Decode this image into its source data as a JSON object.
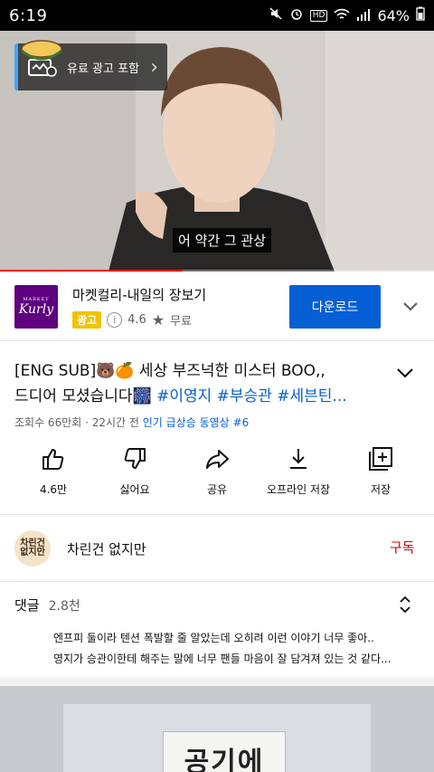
{
  "status": {
    "time": "6:19",
    "battery": "64%",
    "hd": "HD"
  },
  "video": {
    "paid_badge": "유료 광고 포함",
    "subtitle": "어 약간 그 관상",
    "progress": 0.42
  },
  "ad": {
    "logo_text": "Kurly",
    "logo_small": "MARKET",
    "title": "마켓컬리-내일의 장보기",
    "tag": "광고",
    "rating": "4.6",
    "price": "무료",
    "cta": "다운로드"
  },
  "title": {
    "line1": "[ENG SUB]🐻🍊 세상 부즈넉한 미스터 BOO,,",
    "line2_text": "드디어 모셨습니다🎆 ",
    "line2_tags": "#이영지 #부승관 #세븐틴..."
  },
  "meta": {
    "views_time": "조회수 66만회 · 22시간 전 ",
    "trending": "인기 급상승 동영상 #6"
  },
  "actions": [
    {
      "label": "4.6만",
      "icon": "thumbs-up-icon"
    },
    {
      "label": "싫어요",
      "icon": "thumbs-down-icon"
    },
    {
      "label": "공유",
      "icon": "share-icon"
    },
    {
      "label": "오프라인 저장",
      "icon": "download-icon"
    },
    {
      "label": "저장",
      "icon": "add-to-playlist-icon"
    }
  ],
  "channel": {
    "avatar_text": "차린건 없지만",
    "name": "차린건 없지만",
    "subscribe": "구독"
  },
  "comments": {
    "label": "댓글",
    "count": "2.8천",
    "top_comment_line1": "엔프피 둘이라 텐션 폭발할 줄 알았는데 오히려 이런 이야기 너무 좋아..",
    "top_comment_line2": "영지가 승관이한테 해주는 말에 너무 팬들 마음이 잘 담겨져 있는 것 같다..."
  },
  "next_thumb": {
    "sign": "공기에"
  },
  "colors": {
    "accent": "#065fd4",
    "progress": "#ff0000",
    "subscribe": "#cc0000",
    "ad_tag": "#f2c200",
    "brand": "#5f0080"
  }
}
